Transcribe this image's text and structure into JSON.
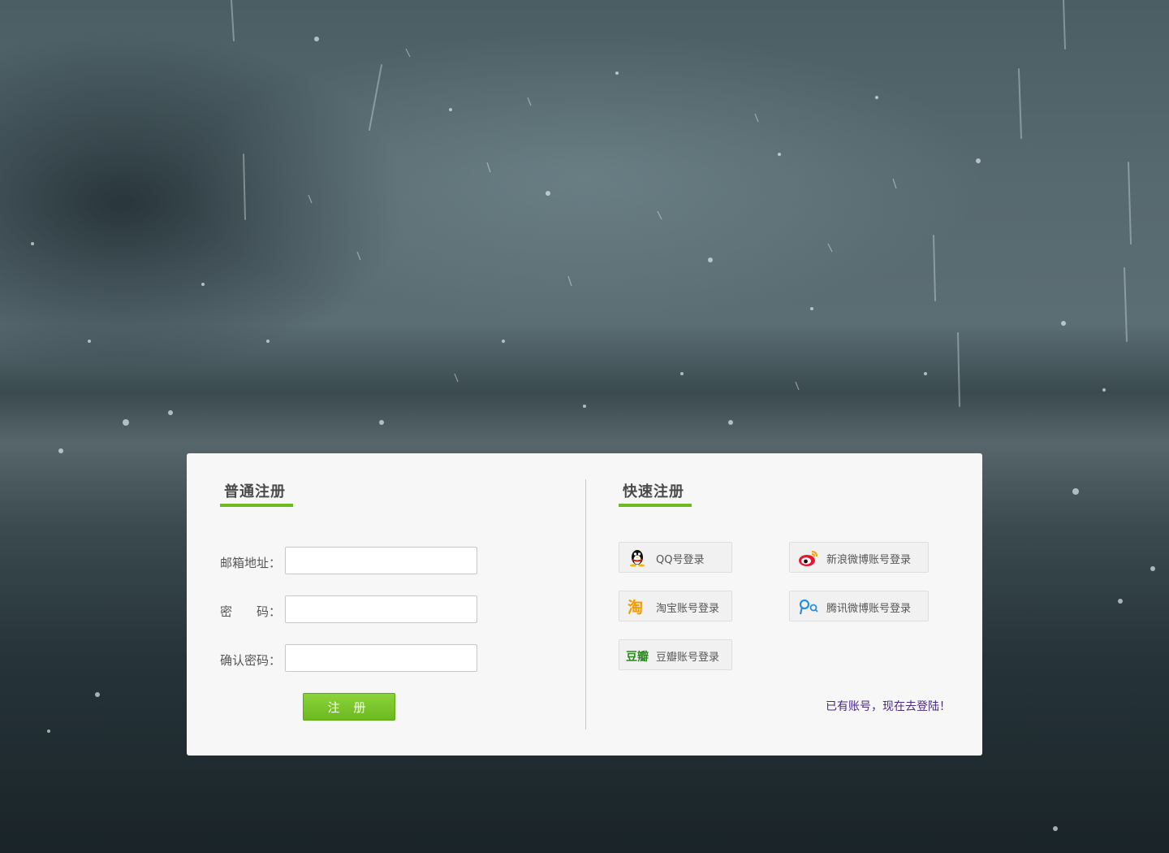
{
  "normal_register": {
    "title": "普通注册",
    "email_label": "邮箱地址：",
    "password_label": "密　　码：",
    "confirm_label": "确认密码：",
    "email_value": "",
    "password_value": "",
    "confirm_value": "",
    "submit_label": "注 册"
  },
  "quick_register": {
    "title": "快速注册",
    "qq_label": "QQ号登录",
    "sina_label": "新浪微博账号登录",
    "taobao_label": "淘宝账号登录",
    "tencent_label": "腾讯微博账号登录",
    "douban_label": "豆瓣账号登录",
    "have_account_link": "已有账号，现在去登陆！"
  },
  "colors": {
    "accent_green": "#6fbb1f",
    "link_purple": "#4b2a86",
    "panel_bg": "#f7f7f7"
  },
  "icons": {
    "qq": "qq-penguin-icon",
    "sina": "sina-weibo-icon",
    "taobao": "taobao-icon",
    "tencent": "tencent-weibo-icon",
    "douban": "douban-icon"
  }
}
